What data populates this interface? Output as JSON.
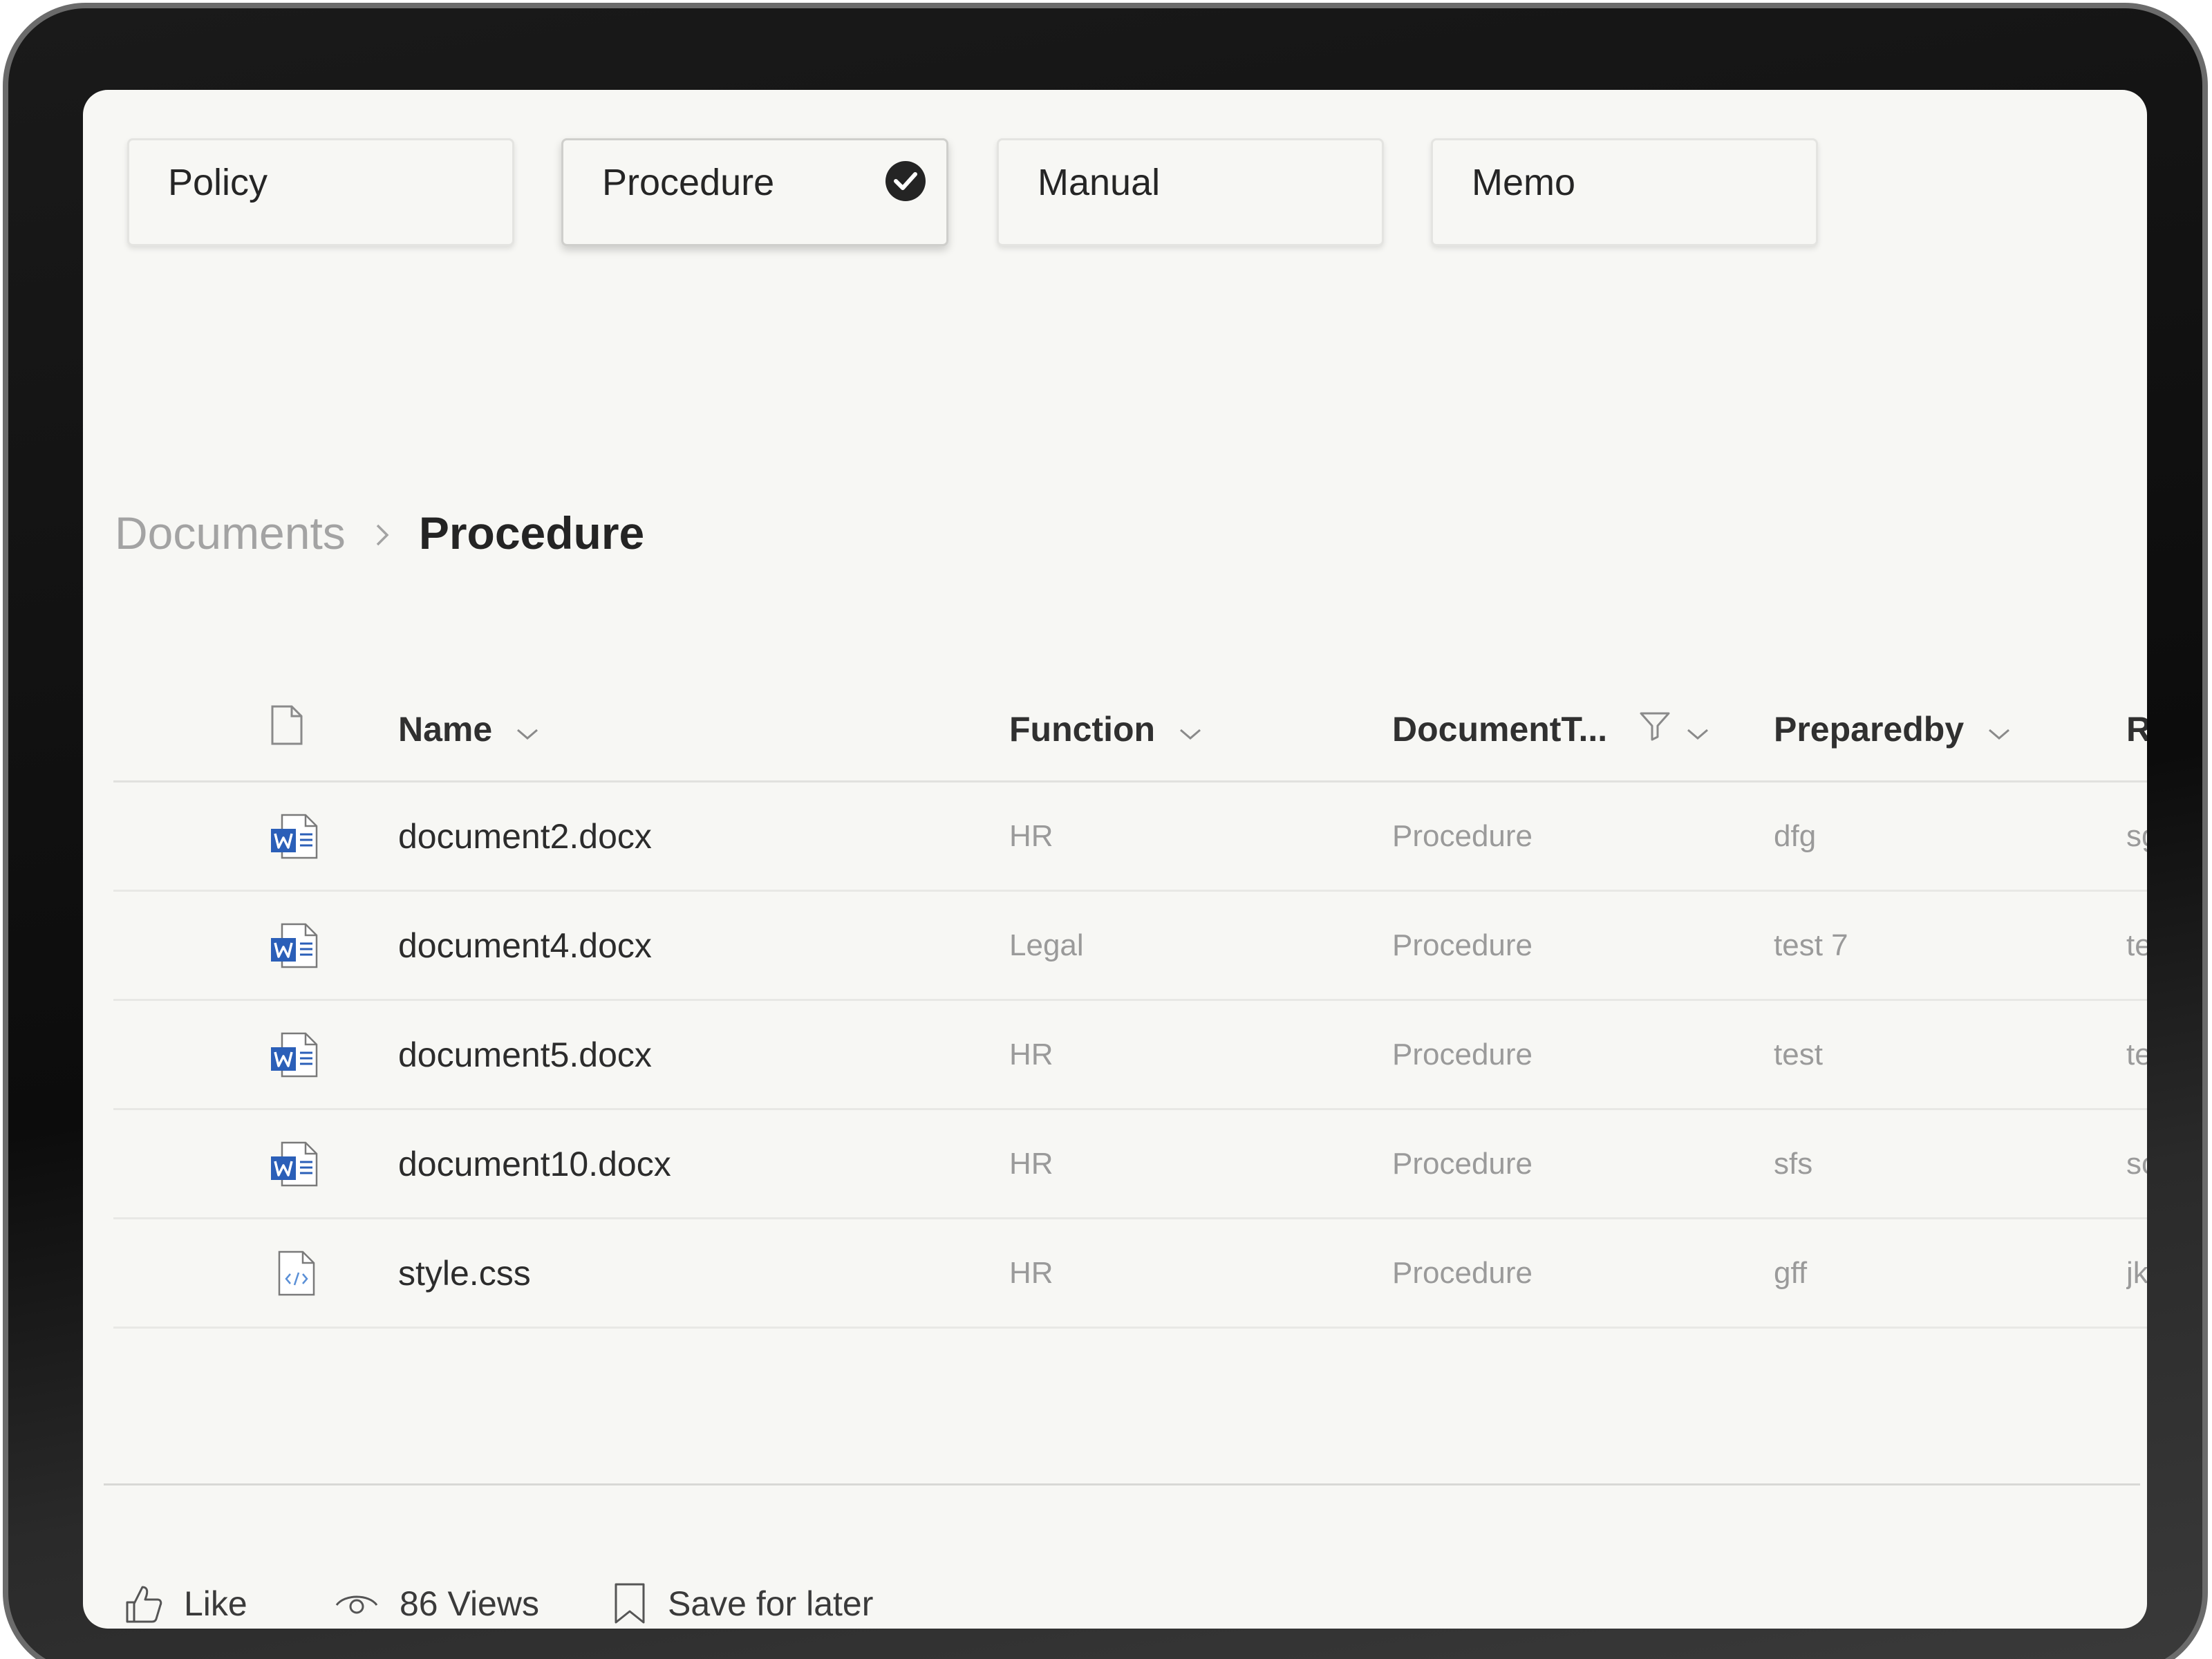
{
  "tiles": [
    {
      "label": "Policy",
      "selected": false
    },
    {
      "label": "Procedure",
      "selected": true
    },
    {
      "label": "Manual",
      "selected": false
    },
    {
      "label": "Memo",
      "selected": false
    }
  ],
  "breadcrumb": {
    "root": "Documents",
    "separator_icon": "chevron-right-icon",
    "current": "Procedure"
  },
  "table": {
    "columns": {
      "file_type_icon": "file-icon",
      "name": "Name",
      "function": "Function",
      "document_type": "DocumentT...",
      "prepared_by": "Preparedby",
      "r": "R"
    },
    "rows": [
      {
        "icon": "word-doc-icon",
        "name": "document2.docx",
        "function": "HR",
        "document_type": "Procedure",
        "prepared_by": "dfg",
        "r": "sg"
      },
      {
        "icon": "word-doc-icon",
        "name": "document4.docx",
        "function": "Legal",
        "document_type": "Procedure",
        "prepared_by": "test 7",
        "r": "te"
      },
      {
        "icon": "word-doc-icon",
        "name": "document5.docx",
        "function": "HR",
        "document_type": "Procedure",
        "prepared_by": "test",
        "r": "te"
      },
      {
        "icon": "word-doc-icon",
        "name": "document10.docx",
        "function": "HR",
        "document_type": "Procedure",
        "prepared_by": "sfs",
        "r": "sc"
      },
      {
        "icon": "code-file-icon",
        "name": "style.css",
        "function": "HR",
        "document_type": "Procedure",
        "prepared_by": "gff",
        "r": "jk"
      }
    ]
  },
  "footer": {
    "like": "Like",
    "views": "86 Views",
    "save": "Save for later"
  },
  "colors": {
    "screen_bg": "#f7f7f4",
    "word_blue": "#2b5fb8",
    "text_dark": "#242424",
    "text_muted": "#9a9a9a"
  }
}
